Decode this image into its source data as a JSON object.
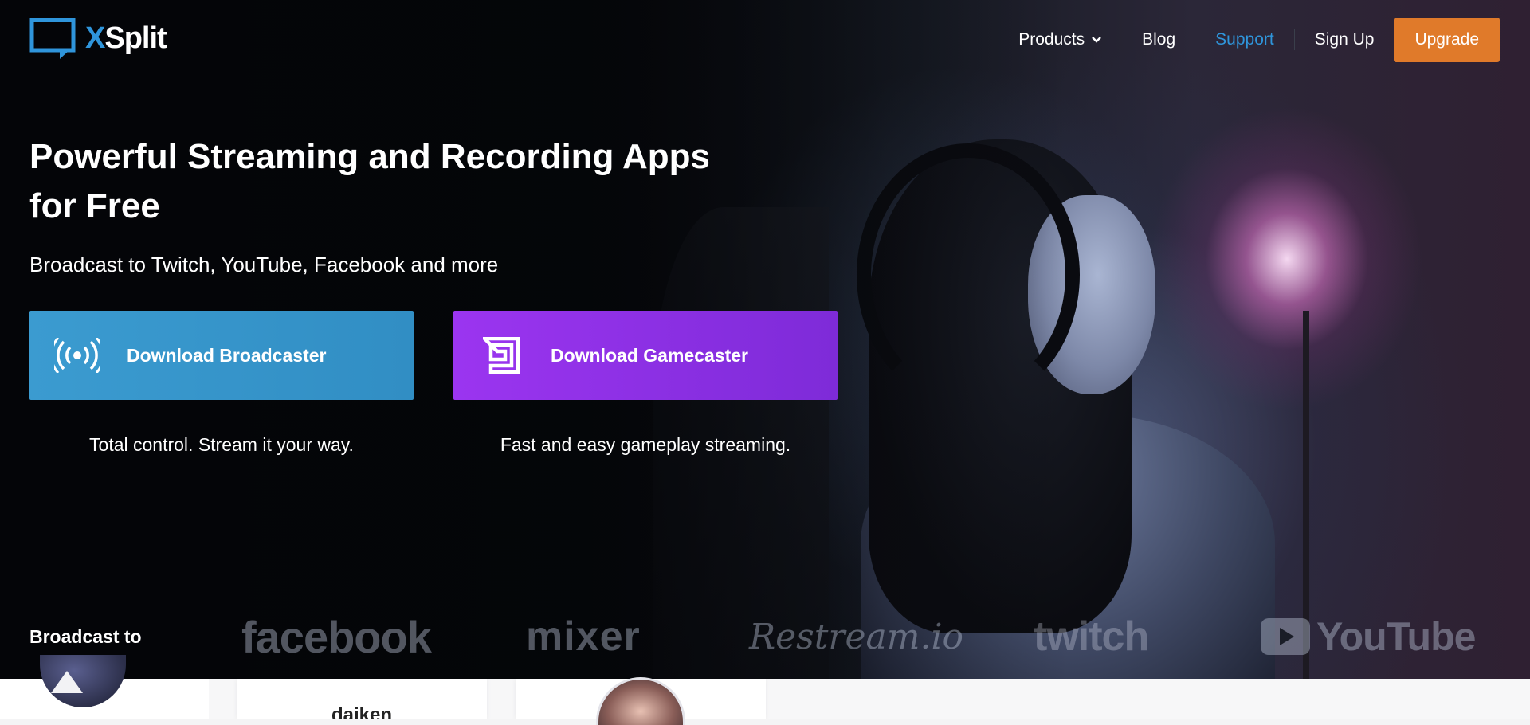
{
  "brand": {
    "name": "XSplit",
    "name_x": "X",
    "name_rest": "Split",
    "accent": "#2f95db"
  },
  "nav": {
    "products": "Products",
    "blog": "Blog",
    "support": "Support",
    "signup": "Sign Up",
    "upgrade": "Upgrade",
    "upgrade_color": "#e07a2a"
  },
  "hero": {
    "headline": "Powerful Streaming and Recording Apps for Free",
    "subheadline": "Broadcast to Twitch, YouTube, Facebook and more"
  },
  "downloads": [
    {
      "label": "Download Broadcaster",
      "tagline": "Total control. Stream it your way.",
      "icon": "broadcast-signal-icon",
      "color": "#3b9bd0"
    },
    {
      "label": "Download Gamecaster",
      "tagline": "Fast and easy gameplay streaming.",
      "icon": "gamecaster-logo-icon",
      "color": "#9b35f0"
    }
  ],
  "broadcast_to": {
    "label": "Broadcast to",
    "platforms": [
      "facebook",
      "mixer",
      "Restream.io",
      "twitch",
      "YouTube"
    ]
  },
  "cards": [
    {
      "name": "daiken"
    }
  ]
}
